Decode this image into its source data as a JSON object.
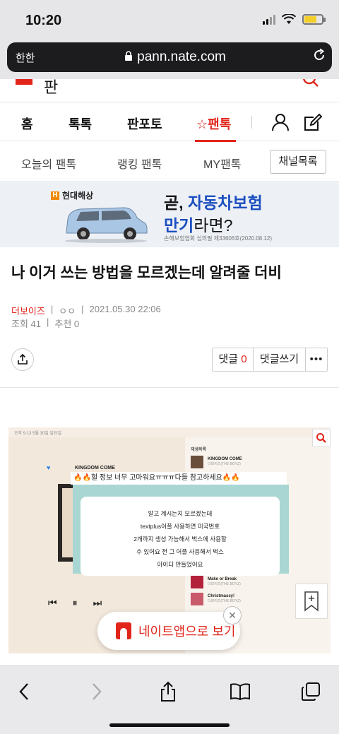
{
  "status_bar": {
    "time": "10:20"
  },
  "address_bar": {
    "aa_label": "한한",
    "url": "pann.nate.com"
  },
  "site_header": {
    "logo_text": "판"
  },
  "main_nav": {
    "items": [
      "홈",
      "톡톡",
      "판포토",
      "☆팬톡"
    ],
    "active_index": 3
  },
  "sub_nav": {
    "items": [
      "오늘의 팬톡",
      "랭킹 팬톡",
      "MY팬톡"
    ],
    "channel_list_button": "채널목록"
  },
  "ad": {
    "brand": "현대해상",
    "line1_prefix": "곧, ",
    "line1_accent": "자동차보험",
    "line2_accent": "만기",
    "line2_rest": "라면?",
    "note": "손해보험협회 심의필 제33606호(2020.08.12)"
  },
  "article": {
    "title": "나 이거 쓰는 방법을 모르겠는데 알려줄 더비",
    "author": "더보이즈",
    "author_sub": "ㅇㅇ",
    "datetime": "2021.05.30 22:06",
    "views": "조회 41",
    "recommends": "추천 0",
    "comment_label": "댓글",
    "comment_count": "0",
    "write_comment_label": "댓글쓰기",
    "more_label": "•••"
  },
  "embedded_image": {
    "status_text": "오후 9:13  5월 30일 일요일",
    "song_title": "KINGDOM COME",
    "caption": "🔥🔥헐 정보 너무 고마워요ㅠㅠㅠ다들 참고하세요🔥🔥",
    "popup_lines": [
      "알고 계시는지 모르겠는데",
      "textplus어플 사용하면 미국번호",
      "2개까지 생성 가능해서 벅스에 사용할",
      "수 있어요 전 그 어플 사용해서 벅스",
      "아이디 만들었어요"
    ],
    "playlist_header": "재생목록",
    "playlist": [
      {
        "title": "KINGDOM COME",
        "artist": "더보이즈(THE BOYZ)"
      },
      {
        "title": "Make or Break",
        "artist": "더보이즈(THE BOYZ)"
      },
      {
        "title": "Christmassy!",
        "artist": "더보이즈(THE BOYZ)"
      }
    ]
  },
  "app_banner": {
    "text": "네이트앱으로 보기"
  },
  "colors": {
    "brand_red": "#e1251b",
    "ad_blue": "#1b4fbf"
  }
}
